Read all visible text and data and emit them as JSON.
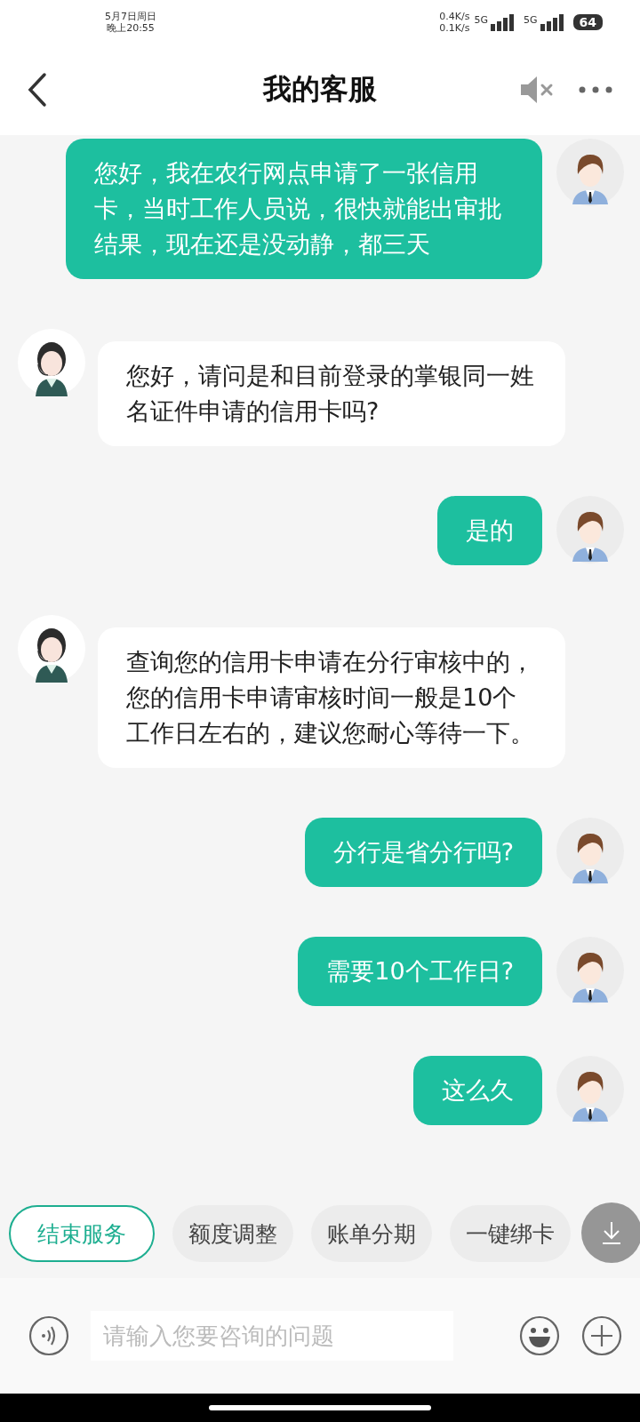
{
  "status_bar": {
    "date": "5月7日周日",
    "time": "晚上20:55",
    "speed_up": "0.4K/s",
    "speed_down": "0.1K/s",
    "network_1": "5G",
    "network_2": "5G",
    "battery": "64"
  },
  "header": {
    "title": "我的客服"
  },
  "messages": [
    {
      "kind": "user",
      "text": "您好，我在农行网点申请了一张信用卡，当时工作人员说，很快就能出审批结果，现在还是没动静，都三天"
    },
    {
      "kind": "agent",
      "text": "您好，请问是和目前登录的掌银同一姓名证件申请的信用卡吗?"
    },
    {
      "kind": "user",
      "text": "是的"
    },
    {
      "kind": "agent",
      "text": "查询您的信用卡申请在分行审核中的，您的信用卡申请审核时间一般是10个工作日左右的，建议您耐心等待一下。"
    },
    {
      "kind": "user",
      "text": "分行是省分行吗?"
    },
    {
      "kind": "user",
      "text": "需要10个工作日?"
    },
    {
      "kind": "user",
      "text": "这么久"
    }
  ],
  "quick_actions": [
    {
      "label": "结束服务",
      "kind": "primary"
    },
    {
      "label": "额度调整",
      "kind": "chip"
    },
    {
      "label": "账单分期",
      "kind": "chip"
    },
    {
      "label": "一键绑卡",
      "kind": "chip"
    }
  ],
  "input": {
    "placeholder": "请输入您要咨询的问题"
  }
}
